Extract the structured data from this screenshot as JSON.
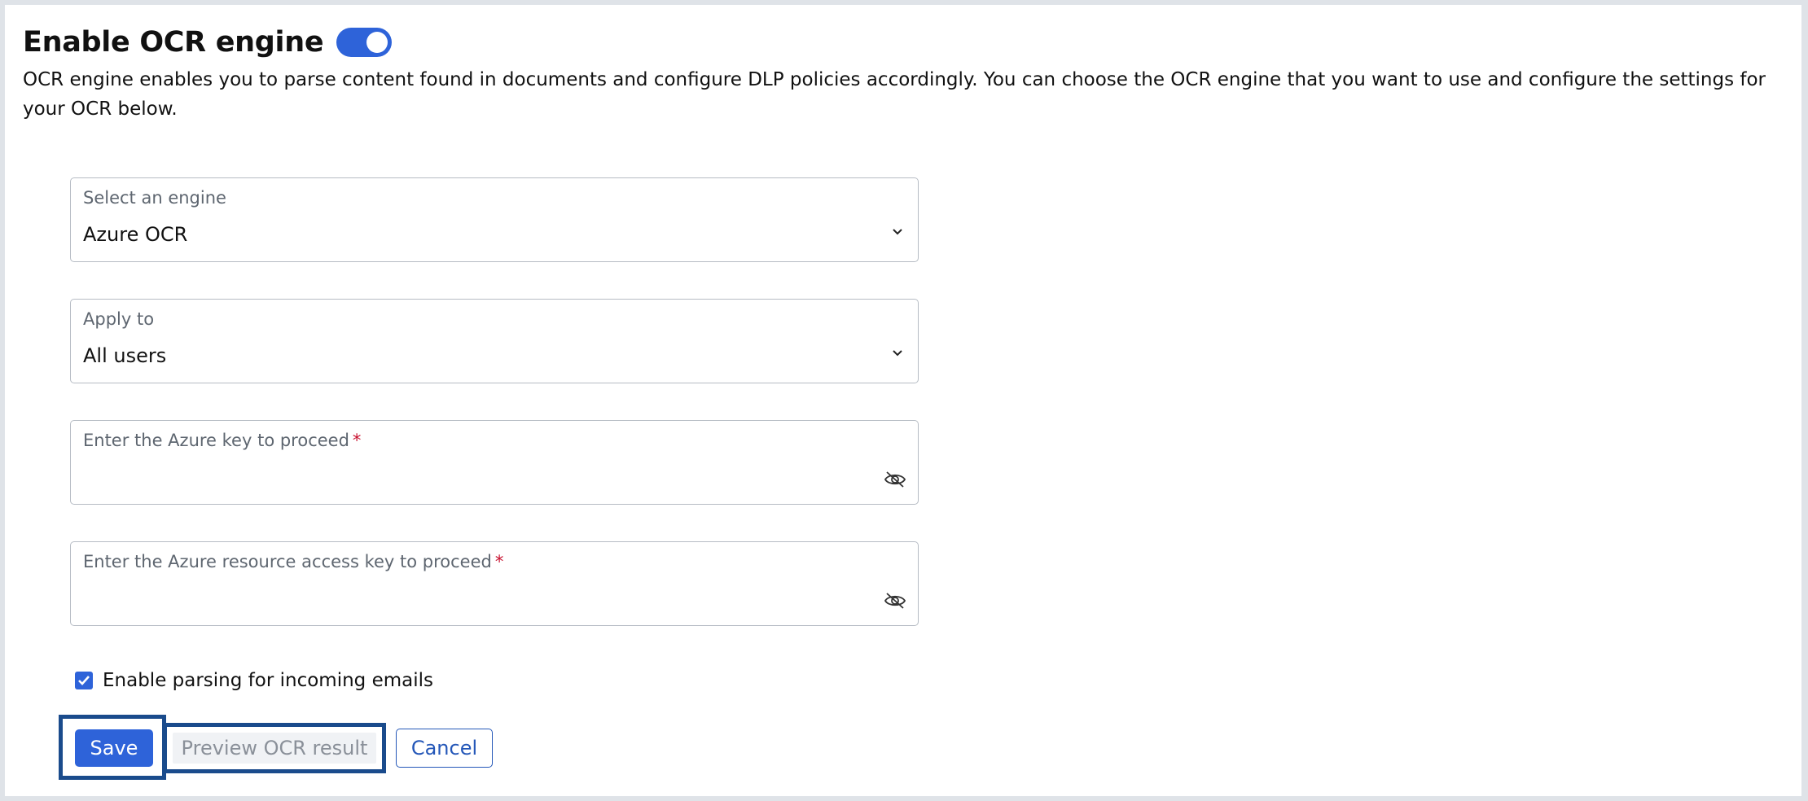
{
  "header": {
    "title": "Enable OCR engine",
    "toggle_state": "on"
  },
  "description": "OCR engine enables you to parse content found in documents and configure DLP policies accordingly. You can choose the OCR engine that you want to use and configure the settings for your OCR below.",
  "fields": {
    "engine": {
      "label": "Select an engine",
      "value": "Azure OCR"
    },
    "apply_to": {
      "label": "Apply to",
      "value": "All users"
    },
    "azure_key": {
      "label": "Enter the Azure key to proceed",
      "required_marker": "*",
      "value": ""
    },
    "resource_key": {
      "label": "Enter the Azure resource access key to proceed",
      "required_marker": "*",
      "value": ""
    }
  },
  "checkbox": {
    "label": "Enable parsing for incoming emails",
    "checked": true
  },
  "buttons": {
    "save": "Save",
    "preview": "Preview OCR result",
    "cancel": "Cancel"
  },
  "colors": {
    "accent": "#2e63d9",
    "focus_ring": "#1a4b8c",
    "required": "#c8102e",
    "link": "#2457b8"
  },
  "icons": {
    "dropdown": "chevron-down-icon",
    "password_toggle": "eye-off-icon",
    "checkmark": "checkmark-icon"
  }
}
